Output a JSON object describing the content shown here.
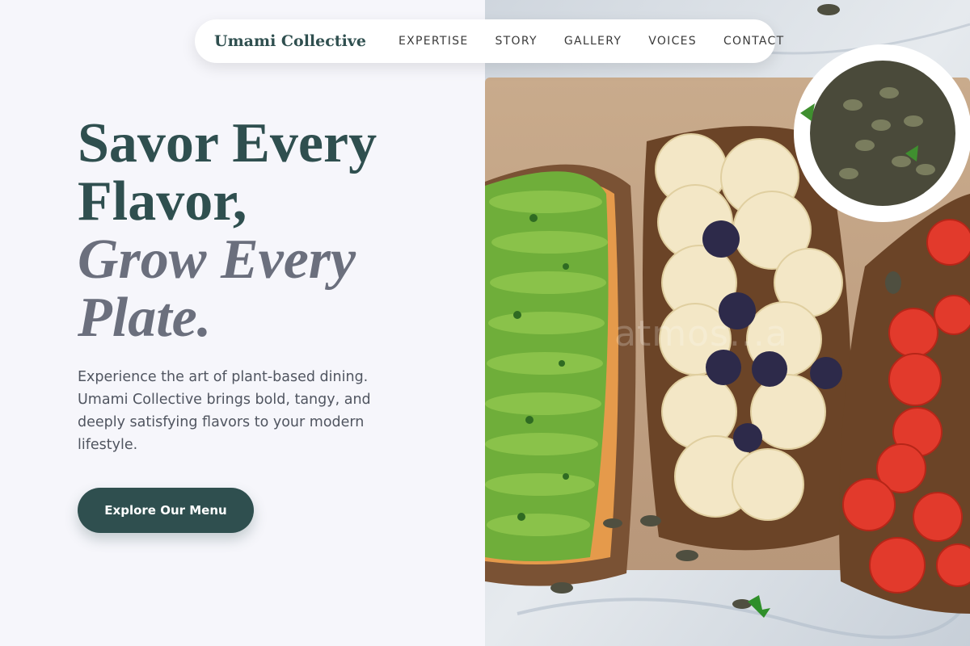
{
  "brand": "Umami Collective",
  "nav": {
    "links": [
      "EXPERTISE",
      "STORY",
      "GALLERY",
      "VOICES",
      "CONTACT"
    ]
  },
  "hero": {
    "title_line1": "Savor Every",
    "title_line2": "Flavor,",
    "title_line3": "Grow Every",
    "title_line4": "Plate.",
    "description": "Experience the art of plant-based dining. Umami Collective brings bold, tangy, and deeply satisfying flavors to your modern lifestyle.",
    "cta_label": "Explore Our Menu"
  },
  "photo": {
    "watermark": "atmos...a"
  },
  "colors": {
    "brand": "#2f4f4f",
    "accent_italic": "#6b6f7d",
    "background": "#f6f6fb"
  }
}
